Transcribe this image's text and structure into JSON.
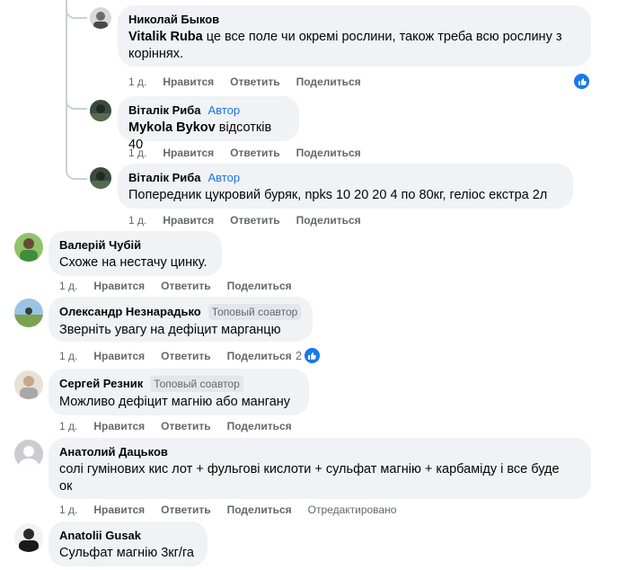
{
  "comments": [
    {
      "author": "Николай Быков",
      "mention": "Vitalik Ruba",
      "text_line1": " це все поле чи окремі рослини, також треба всю рослину з",
      "text_line2": "коріннях.",
      "time": "1 д.",
      "like": "Нравится",
      "reply": "Ответить",
      "share": "Поделиться",
      "reaction_count": ""
    },
    {
      "author": "Віталік Риба",
      "badge": "Автор",
      "mention": "Mykola Bykov",
      "text": " відсотків 40",
      "time": "1 д.",
      "like": "Нравится",
      "reply": "Ответить",
      "share": "Поделиться"
    },
    {
      "author": "Віталік Риба",
      "badge": "Автор",
      "text": "Попередник цукровий буряк, npks 10 20 20 4 по 80кг, геліос екстра 2л",
      "time": "1 д.",
      "like": "Нравится",
      "reply": "Ответить",
      "share": "Поделиться"
    },
    {
      "author": "Валерій Чубій",
      "text": "Схоже на нестачу цинку.",
      "time": "1 д.",
      "like": "Нравится",
      "reply": "Ответить",
      "share": "Поделиться"
    },
    {
      "author": "Олександр Незнарадько",
      "badge": "Топовый соавтор",
      "text": "Зверніть увагу на дефіцит марганцю",
      "time": "1 д.",
      "like": "Нравится",
      "reply": "Ответить",
      "share": "Поделиться",
      "reaction_count": "2"
    },
    {
      "author": "Сергей Резник",
      "badge": "Топовый соавтор",
      "text": "Можливо дефіцит магнію або мангану",
      "time": "1 д.",
      "like": "Нравится",
      "reply": "Ответить",
      "share": "Поделиться"
    },
    {
      "author": "Анатолий Дацьков",
      "text_line1": "солі гумінових кис лот + фульгові кислоти + сульфат магнію + карбаміду і все буде",
      "text_line2": "ок",
      "time": "1 д.",
      "like": "Нравится",
      "reply": "Ответить",
      "share": "Поделиться",
      "edited": "Отредактировано"
    },
    {
      "author": "Anatolii Gusak",
      "text": "Сульфат магнію 3кг/га"
    }
  ],
  "colors": {
    "bubble": "#f0f2f5",
    "link_blue": "#1b74e4",
    "like_blue": "#1877f2",
    "meta_gray": "#65676b"
  },
  "icons": {
    "like": "thumbs-up-icon"
  }
}
